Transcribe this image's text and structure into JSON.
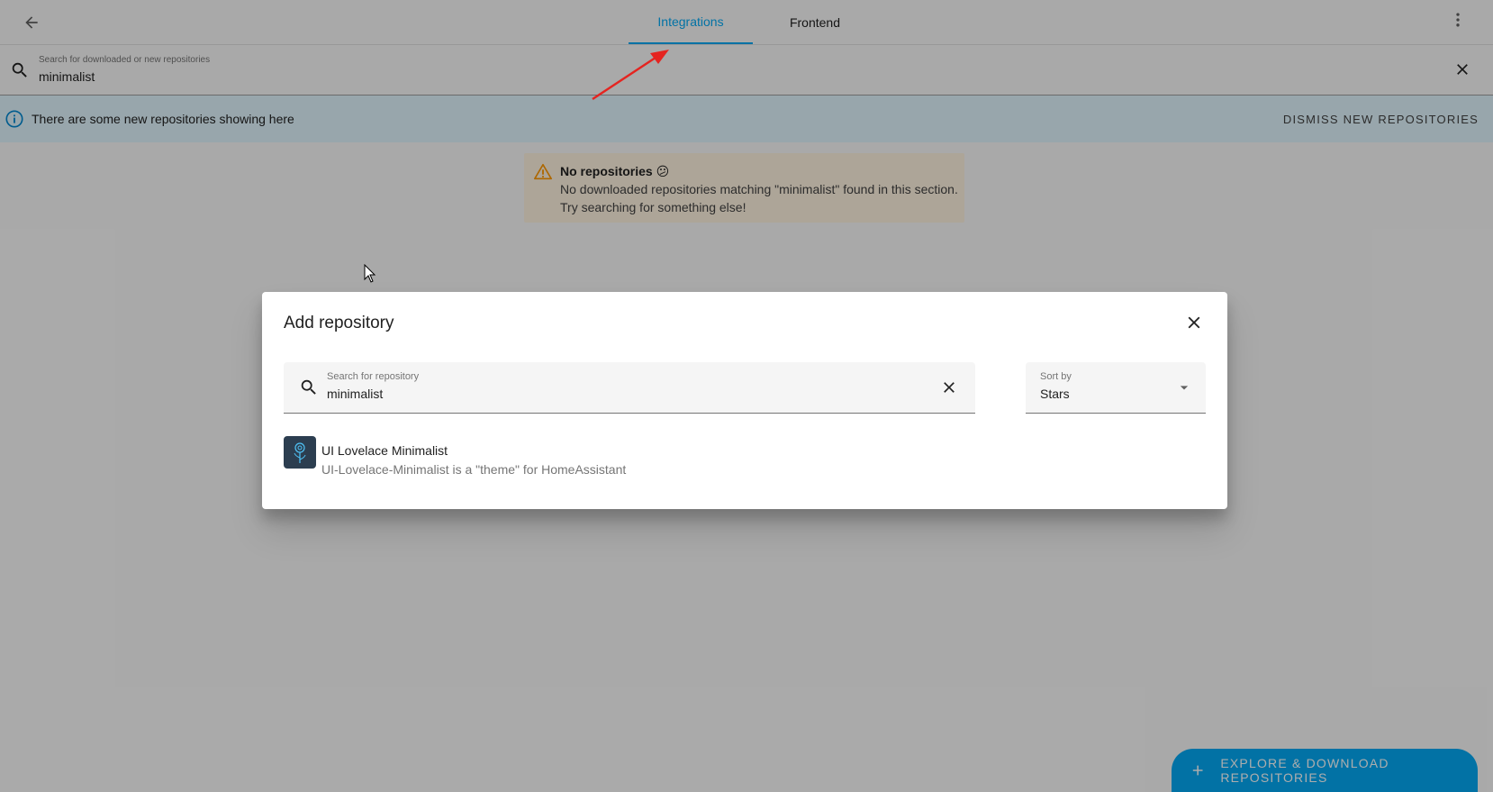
{
  "tabs": [
    {
      "label": "Integrations",
      "active": true
    },
    {
      "label": "Frontend",
      "active": false
    }
  ],
  "search": {
    "label": "Search for downloaded or new repositories",
    "value": "minimalist"
  },
  "info_banner": {
    "text": "There are some new repositories showing here",
    "dismiss_label": "DISMISS NEW REPOSITORIES"
  },
  "warning": {
    "title": "No repositories 😕",
    "line1": "No downloaded repositories matching \"minimalist\" found in this section.",
    "line2": "Try searching for something else!"
  },
  "fab": {
    "label": "EXPLORE & DOWNLOAD REPOSITORIES"
  },
  "dialog": {
    "title": "Add repository",
    "search_label": "Search for repository",
    "search_value": "minimalist",
    "sort_label": "Sort by",
    "sort_value": "Stars",
    "results": [
      {
        "name": "UI Lovelace Minimalist",
        "description": "UI-Lovelace-Minimalist is a \"theme\" for HomeAssistant"
      }
    ]
  },
  "icons": {
    "back": "arrow-left-icon",
    "menu": "dots-vertical-icon",
    "search": "magnify-icon",
    "clear": "close-icon",
    "info": "information-outline-icon",
    "warning": "alert-triangle-icon",
    "dropdown": "menu-down-icon",
    "plus": "plus-icon"
  },
  "colors": {
    "accent": "#03a9f4",
    "info_bg": "#e1f5fe",
    "warning_bg": "#fff3e0",
    "warning_icon": "#ff9800",
    "annotation_arrow": "#e52420"
  }
}
